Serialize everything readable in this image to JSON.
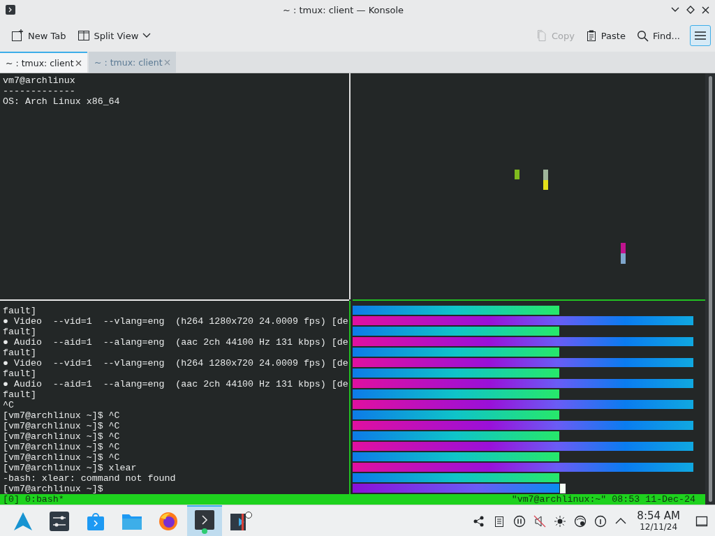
{
  "window": {
    "title": "~ : tmux: client — Konsole"
  },
  "toolbar": {
    "left": [
      {
        "label": "New Tab",
        "kind": "new-tab"
      },
      {
        "label": "Split View",
        "kind": "split-view"
      }
    ],
    "right": [
      {
        "label": "Copy",
        "kind": "copy",
        "disabled": true
      },
      {
        "label": "Paste",
        "kind": "paste",
        "disabled": false
      },
      {
        "label": "Find...",
        "kind": "find",
        "disabled": false
      }
    ]
  },
  "tabs": [
    {
      "label": "~ : tmux: client",
      "selected": true
    },
    {
      "label": "~ : tmux: client",
      "selected": false
    }
  ],
  "terminal": {
    "top_left_lines": [
      "vm7@archlinux",
      "-------------",
      "OS: Arch Linux x86_64"
    ],
    "bottom_left_lines": [
      "fault]",
      "● Video  --vid=1  --vlang=eng  (h264 1280x720 24.0009 fps) [de",
      "fault]",
      "● Audio  --aid=1  --alang=eng  (aac 2ch 44100 Hz 131 kbps) [de",
      "fault]",
      "● Video  --vid=1  --vlang=eng  (h264 1280x720 24.0009 fps) [de",
      "fault]",
      "● Audio  --aid=1  --alang=eng  (aac 2ch 44100 Hz 131 kbps) [de",
      "fault]",
      "^C",
      "[vm7@archlinux ~]$ ^C",
      "[vm7@archlinux ~]$ ^C",
      "[vm7@archlinux ~]$ ^C",
      "[vm7@archlinux ~]$ ^C",
      "[vm7@archlinux ~]$ ^C",
      "[vm7@archlinux ~]$ xlear",
      "-bash: xlear: command not found",
      "[vm7@archlinux ~]$"
    ],
    "status": {
      "left": "[0] 0:bash*",
      "right": "\"vm7@archlinux:~\" 08:53 11-Dec-24"
    }
  },
  "taskbar": {
    "apps": [
      {
        "kind": "launcher",
        "active": false
      },
      {
        "kind": "settings",
        "active": false
      },
      {
        "kind": "store",
        "active": false
      },
      {
        "kind": "folder",
        "active": false
      },
      {
        "kind": "browser",
        "active": false
      },
      {
        "kind": "terminal",
        "active": true
      },
      {
        "kind": "media",
        "active": false
      }
    ],
    "clock": {
      "time": "8:54 AM",
      "date": "12/11/24"
    }
  }
}
